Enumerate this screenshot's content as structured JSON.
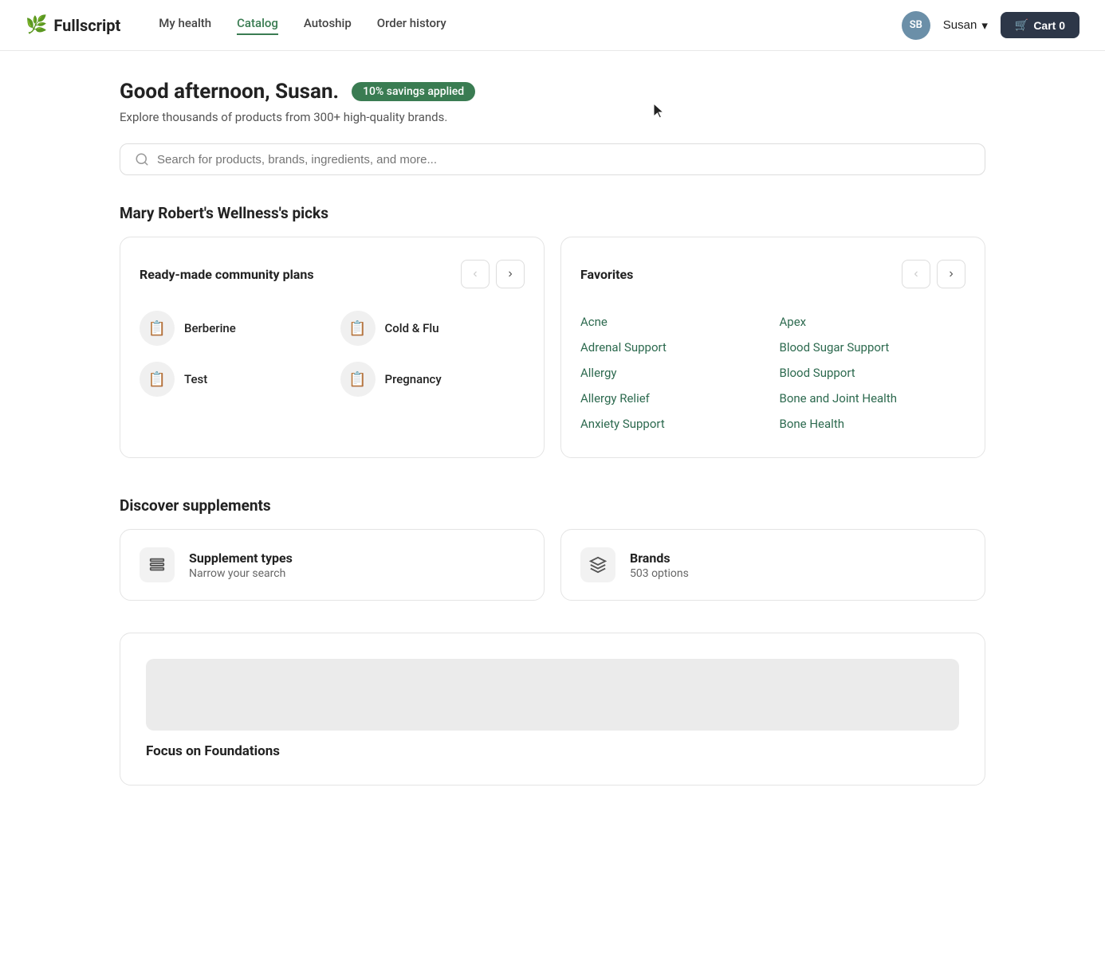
{
  "logo": {
    "name": "Fullscript",
    "icon": "🌿"
  },
  "nav": {
    "links": [
      {
        "label": "My health",
        "active": false
      },
      {
        "label": "Catalog",
        "active": true
      },
      {
        "label": "Autoship",
        "active": false
      },
      {
        "label": "Order history",
        "active": false
      }
    ],
    "user": {
      "initials": "SB",
      "name": "Susan"
    },
    "cart": {
      "label": "Cart 0"
    }
  },
  "greeting": {
    "title": "Good afternoon, Susan.",
    "badge": "10% savings applied",
    "subtitle": "Explore thousands of products from 300+ high-quality brands."
  },
  "search": {
    "placeholder": "Search for products, brands, ingredients, and more..."
  },
  "picks": {
    "section_title": "Mary Robert's Wellness's picks",
    "ready_made": {
      "title": "Ready-made community plans",
      "items": [
        {
          "label": "Berberine"
        },
        {
          "label": "Cold & Flu"
        },
        {
          "label": "Test"
        },
        {
          "label": "Pregnancy"
        }
      ]
    },
    "favorites": {
      "title": "Favorites",
      "items": [
        "Acne",
        "Apex",
        "Adrenal Support",
        "Blood Sugar Support",
        "Allergy",
        "Blood Support",
        "Allergy Relief",
        "Bone and Joint Health",
        "Anxiety Support",
        "Bone Health"
      ]
    }
  },
  "discover": {
    "section_title": "Discover supplements",
    "cards": [
      {
        "title": "Supplement types",
        "sub": "Narrow your search",
        "icon": "☰"
      },
      {
        "title": "Brands",
        "sub": "503 options",
        "icon": "◈"
      }
    ]
  },
  "focus": {
    "title": "Focus on Foundations"
  }
}
